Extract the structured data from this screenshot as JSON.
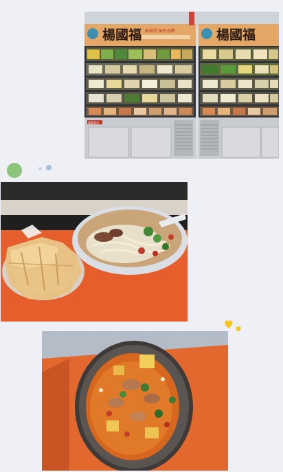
{
  "photos": {
    "fridge": {
      "left_sign": "楊國福",
      "right_sign": "楊國福",
      "left_sign_sub": "麻辣烫 国民品牌",
      "label_tag": "温度显示"
    },
    "noodles": {},
    "stew": {}
  },
  "decorations": {
    "heart_icon": "heart-icon",
    "accent_colors": {
      "green_dot": "#8bc47a",
      "heart": "#f5c518"
    }
  }
}
